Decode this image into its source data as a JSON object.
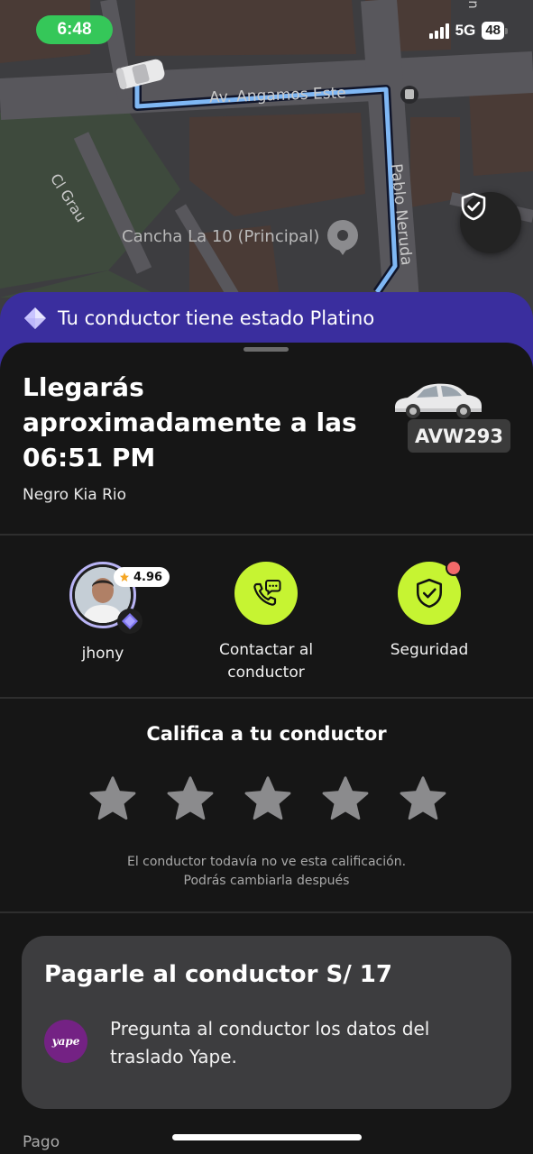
{
  "status_bar": {
    "time": "6:48",
    "network": "5G",
    "battery": "48"
  },
  "map": {
    "streets": {
      "angamos": "Av. Angamos Este",
      "pablo": "Pablo Neruda",
      "grau": "Cl Grau",
      "partial": "n"
    },
    "place": "Cancha La 10 (Principal)"
  },
  "banner": {
    "text": "Tu conductor tiene estado Platino"
  },
  "trip": {
    "eta": "Llegarás aproximadamente a las 06:51 PM",
    "vehicle": "Negro Kia Rio",
    "plate": "AVW293"
  },
  "actions": {
    "driver": {
      "name": "jhony",
      "rating": "4.96"
    },
    "contact": {
      "label": "Contactar al conductor"
    },
    "security": {
      "label": "Seguridad"
    }
  },
  "rating": {
    "title": "Califica a tu conductor",
    "stars": 5,
    "note_line1": "El conductor todavía no ve esta calificación.",
    "note_line2": "Podrás cambiarla después"
  },
  "payment": {
    "title": "Pagarle al conductor S/ 17",
    "description": "Pregunta al conductor los datos del traslado Yape.",
    "method_logo": "yape"
  },
  "footer": {
    "section_label": "Pago"
  },
  "colors": {
    "accent": "#c6f432",
    "banner": "#3a2e9e",
    "route": "#7fb7f4"
  }
}
